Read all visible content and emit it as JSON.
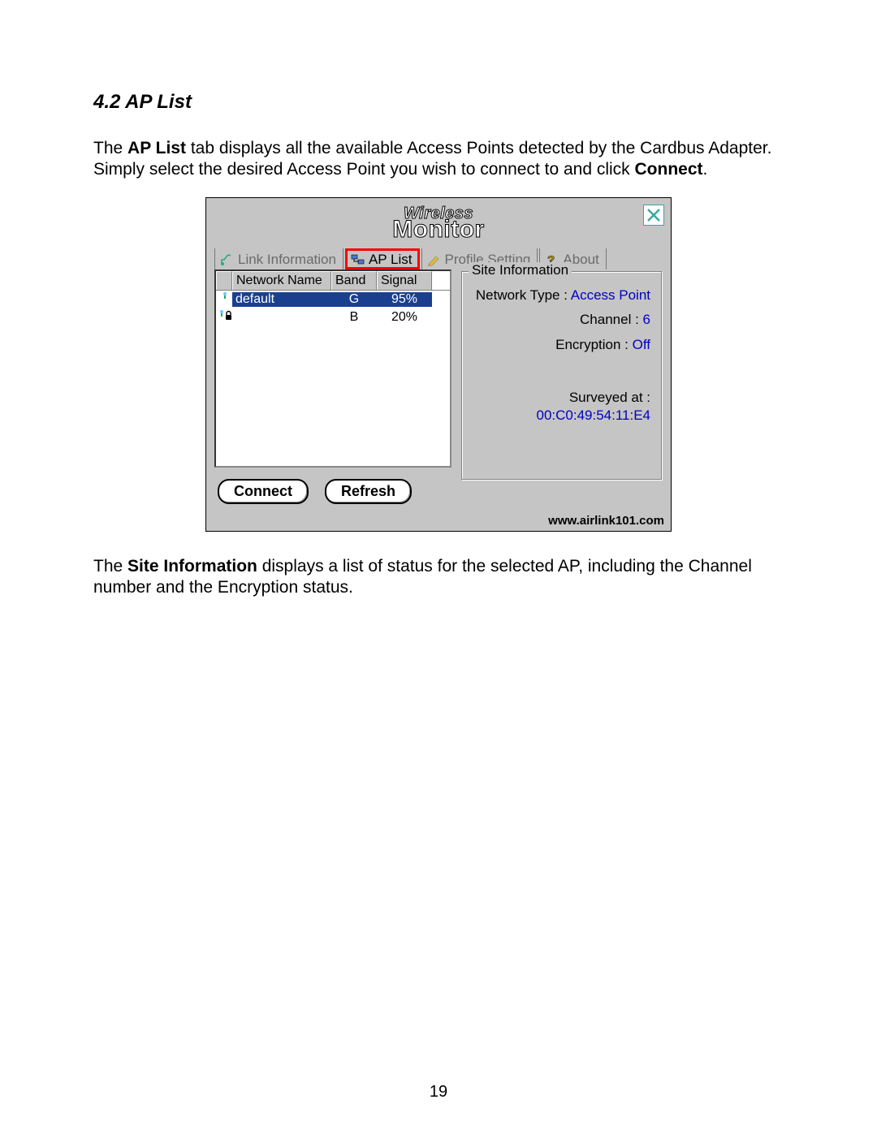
{
  "section": {
    "number": "4.2",
    "title": "AP List"
  },
  "para1": {
    "pre": "The ",
    "bold1": "AP List",
    "mid": " tab displays all the available Access Points detected by the Cardbus Adapter. Simply select the desired Access Point you wish to connect to and click ",
    "bold2": "Connect",
    "post": "."
  },
  "dialog": {
    "brand_top": "Wireless",
    "brand_bottom": "Monitor",
    "tabs": {
      "link_info": "Link Information",
      "ap_list": "AP List",
      "profile": "Profile Setting",
      "about": "About"
    },
    "columns": {
      "name": "Network Name",
      "band": "Band",
      "signal": "Signal"
    },
    "rows": [
      {
        "name": "default",
        "band": "G",
        "signal": "95%"
      },
      {
        "name": "",
        "band": "B",
        "signal": "20%"
      }
    ],
    "buttons": {
      "connect": "Connect",
      "refresh": "Refresh"
    },
    "info": {
      "legend": "Site Information",
      "nt_label": "Network Type :",
      "nt_value": "Access Point",
      "ch_label": "Channel :",
      "ch_value": "6",
      "en_label": "Encryption :",
      "en_value": "Off",
      "sv_label": "Surveyed at :",
      "mac": "00:C0:49:54:11:E4"
    },
    "footer_url": "www.airlink101.com"
  },
  "para2": {
    "pre": "The ",
    "bold1": "Site Information",
    "post": " displays a list of status for the selected AP, including the Channel number and the Encryption status."
  },
  "page_number": "19"
}
